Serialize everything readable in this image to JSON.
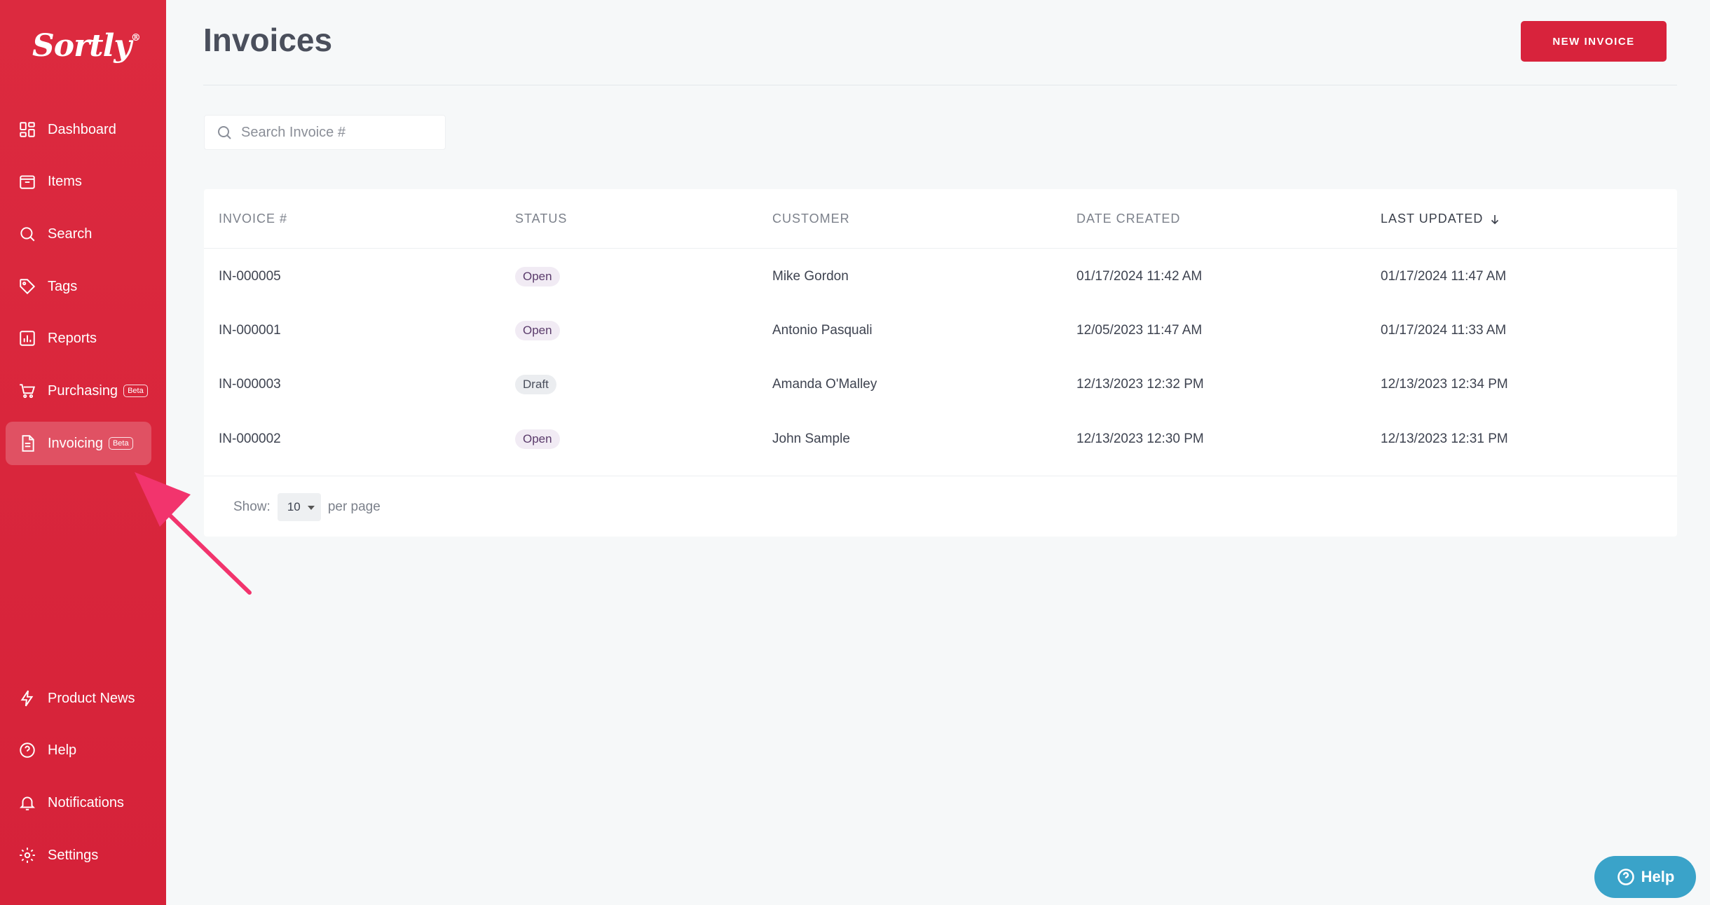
{
  "app": {
    "logo_text": "Sortly",
    "logo_mark": "®"
  },
  "sidebar": {
    "items": [
      {
        "label": "Dashboard",
        "icon": "dashboard-icon"
      },
      {
        "label": "Items",
        "icon": "items-icon"
      },
      {
        "label": "Search",
        "icon": "search-icon"
      },
      {
        "label": "Tags",
        "icon": "tag-icon"
      },
      {
        "label": "Reports",
        "icon": "reports-icon"
      },
      {
        "label": "Purchasing",
        "icon": "cart-icon",
        "badge": "Beta"
      },
      {
        "label": "Invoicing",
        "icon": "invoice-icon",
        "badge": "Beta",
        "active": true
      }
    ],
    "bottom_items": [
      {
        "label": "Product News",
        "icon": "lightning-icon"
      },
      {
        "label": "Help",
        "icon": "help-icon"
      },
      {
        "label": "Notifications",
        "icon": "bell-icon"
      },
      {
        "label": "Settings",
        "icon": "gear-icon"
      }
    ]
  },
  "header": {
    "title": "Invoices",
    "new_invoice_label": "NEW INVOICE"
  },
  "search": {
    "placeholder": "Search Invoice #"
  },
  "table": {
    "columns": [
      "INVOICE #",
      "STATUS",
      "CUSTOMER",
      "DATE CREATED",
      "LAST UPDATED"
    ],
    "sorted_column": "LAST UPDATED",
    "rows": [
      {
        "invoice": "IN-000005",
        "status": "Open",
        "customer": "Mike Gordon",
        "created": "01/17/2024 11:42 AM",
        "updated": "01/17/2024 11:47 AM"
      },
      {
        "invoice": "IN-000001",
        "status": "Open",
        "customer": "Antonio Pasquali",
        "created": "12/05/2023 11:47 AM",
        "updated": "01/17/2024 11:33 AM"
      },
      {
        "invoice": "IN-000003",
        "status": "Draft",
        "customer": "Amanda O'Malley",
        "created": "12/13/2023 12:32 PM",
        "updated": "12/13/2023 12:34 PM"
      },
      {
        "invoice": "IN-000002",
        "status": "Open",
        "customer": "John Sample",
        "created": "12/13/2023 12:30 PM",
        "updated": "12/13/2023 12:31 PM"
      }
    ]
  },
  "pagination": {
    "show_label": "Show:",
    "per_page_value": "10",
    "per_page_label": "per page"
  },
  "help_widget": {
    "label": "Help"
  },
  "colors": {
    "brand": "#d8233c",
    "annotation_arrow": "#f2346d",
    "help_widget": "#3aa3c9"
  }
}
